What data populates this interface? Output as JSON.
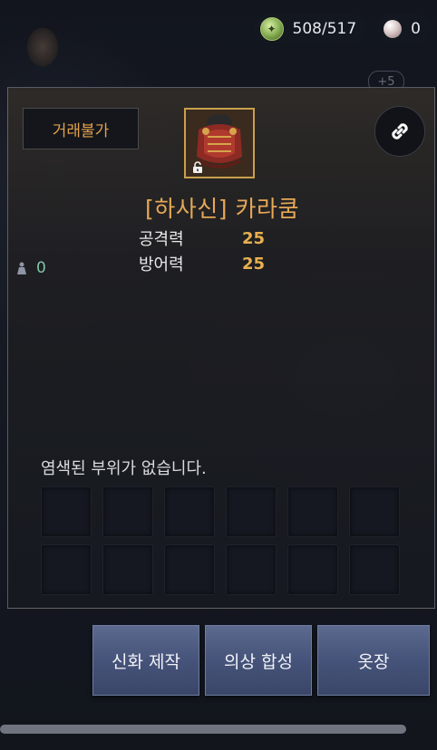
{
  "currency": {
    "energy_value": "508/517",
    "pearl_value": "0"
  },
  "overlay": {
    "plus_badge": "+5"
  },
  "item": {
    "trade_status": "거래불가",
    "name": "[하사신] 카라쿰",
    "stats": [
      {
        "label": "공격력",
        "value": "25"
      },
      {
        "label": "방어력",
        "value": "25"
      }
    ]
  },
  "side_counter": {
    "value": "0"
  },
  "dye": {
    "message": "염색된 부위가 없습니다.",
    "slot_count": 12
  },
  "actions": {
    "craft_label": "신화 제작",
    "combine_label": "의상 합성",
    "wardrobe_label": "옷장"
  },
  "colors": {
    "accent_gold": "#e6a855",
    "stat_value": "#e8b04f",
    "button_blue": "#4a5780",
    "counter_teal": "#7fc6a8"
  },
  "icons": {
    "energy": "energy-coin-icon",
    "pearl": "pearl-icon",
    "link": "link-icon",
    "lock": "lock-icon",
    "weight": "weight-icon"
  }
}
